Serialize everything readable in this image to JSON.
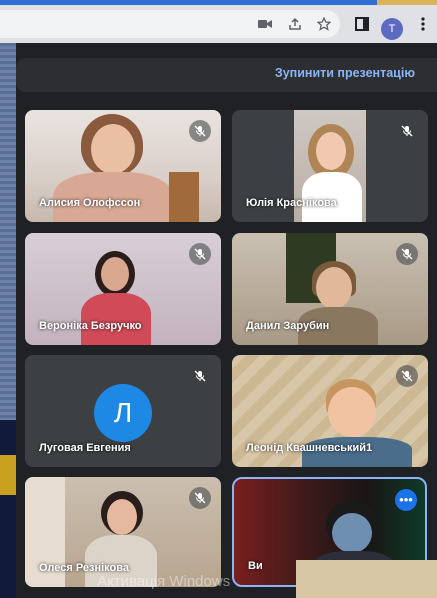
{
  "browser": {
    "icons": [
      "camera-icon",
      "share-icon",
      "star-icon",
      "sidepanel-icon"
    ],
    "profile_initial": "T"
  },
  "meet": {
    "stop_presentation_label": "Зупинити презентацію",
    "participants": [
      {
        "name": "Алисия Олофссон",
        "muted": true
      },
      {
        "name": "Юлія Краснікова",
        "muted": true
      },
      {
        "name": "Вероніка Безручко",
        "muted": true
      },
      {
        "name": "Данил Зарубин",
        "muted": true
      },
      {
        "name": "Луговая Евгения",
        "muted": true,
        "avatar_letter": "Л",
        "avatar_color": "#1e88e5"
      },
      {
        "name": "Леонід Квашневський1",
        "muted": true
      },
      {
        "name": "Олеся Резнікова",
        "muted": true
      },
      {
        "name": "Ви",
        "self": true
      }
    ]
  },
  "os": {
    "activation_watermark": "Активація Windows"
  },
  "colors": {
    "meet_bg": "#202124",
    "accent_blue": "#8ab4f8",
    "avatar_blue": "#1e88e5",
    "selected_outline": "#8ab4f8"
  }
}
